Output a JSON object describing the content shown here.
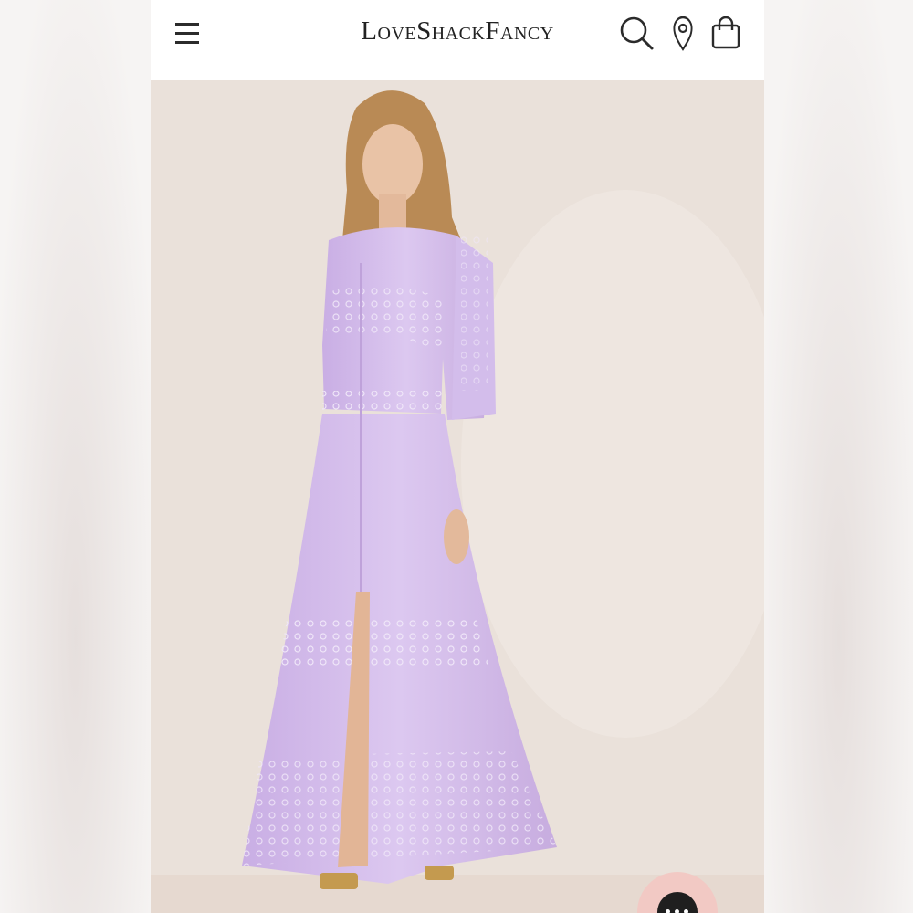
{
  "header": {
    "brand": "LoveShackFancy",
    "menu_icon": "hamburger-menu-icon",
    "search_icon": "search-icon",
    "location_icon": "location-pin-icon",
    "cart_icon": "shopping-bag-icon"
  },
  "colors": {
    "dress": "#cdb4e6",
    "background": "#ece3dc",
    "chat_button": "#f2c9c4"
  },
  "chat": {
    "icon": "chat-ellipsis-icon"
  }
}
